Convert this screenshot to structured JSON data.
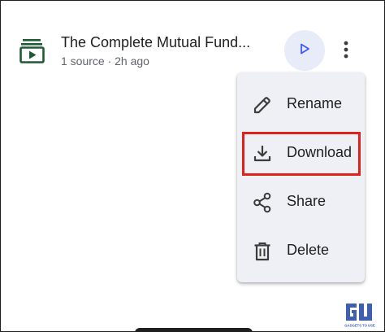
{
  "notebook_item": {
    "title": "The Complete Mutual Fund...",
    "subtitle": "1 source · 2h ago",
    "icon": "notebook-play-icon",
    "play_icon": "play-icon",
    "more_icon": "more-vert-icon"
  },
  "menu": {
    "items": [
      {
        "label": "Rename",
        "icon": "pencil-icon"
      },
      {
        "label": "Download",
        "icon": "download-icon"
      },
      {
        "label": "Share",
        "icon": "share-icon"
      },
      {
        "label": "Delete",
        "icon": "trash-icon"
      }
    ],
    "highlighted_item": "Download"
  },
  "watermark": {
    "text": "GADGETS TO USE"
  },
  "colors": {
    "accent_blue": "#3d5afe",
    "icon_green": "#1e5a32",
    "highlight_red": "#e0201b",
    "menu_bg": "#eef0f5",
    "play_bg": "#e8ebf8"
  }
}
